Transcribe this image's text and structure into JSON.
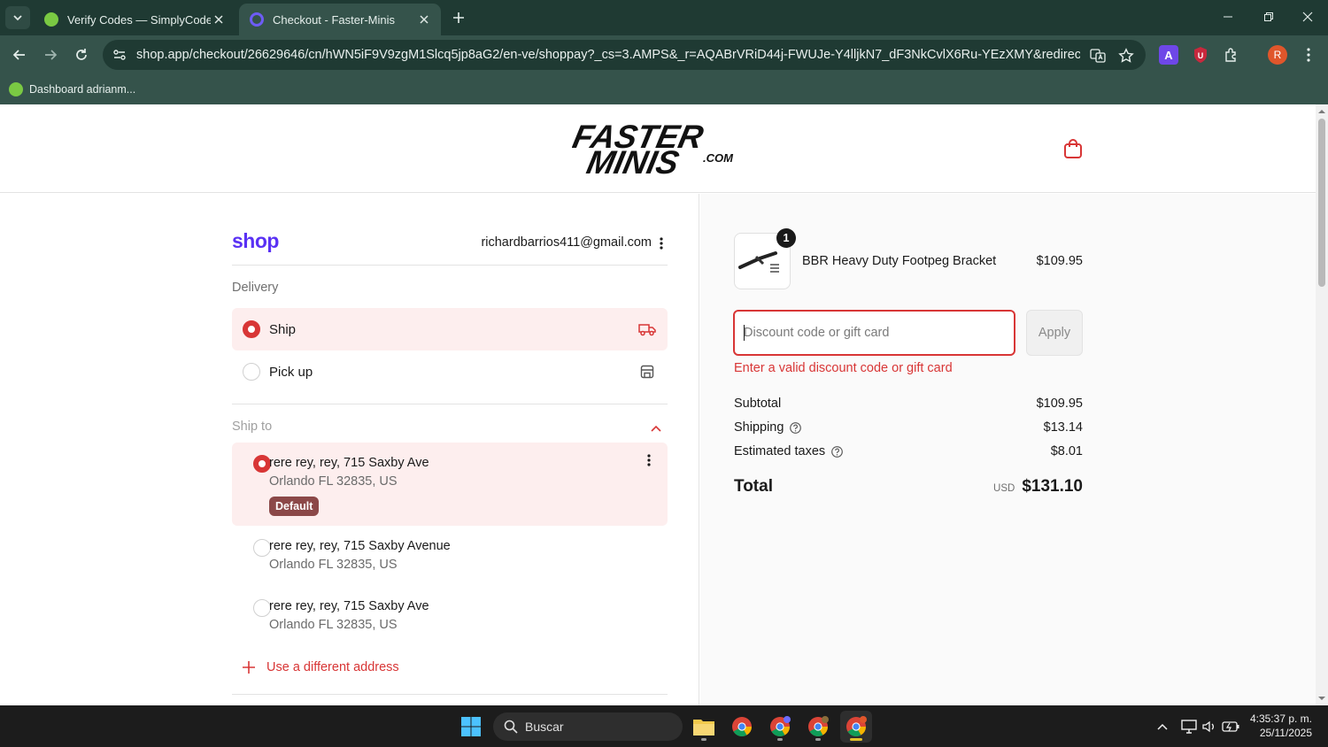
{
  "browser": {
    "tabs": [
      {
        "title": "Verify Codes — SimplyCodes",
        "favicon_color": "#7ac943"
      },
      {
        "title": "Checkout - Faster-Minis",
        "favicon_color": "#6d5cf5",
        "active": true
      }
    ],
    "url": "shop.app/checkout/26629646/cn/hWN5iF9V9zgM1Slcq5jp8aG2/en-ve/shoppay?_cs=3.AMPS&_r=AQABrVRiD44j-FWUJe-Y4lljkN7_dF3NkCvlX6Ru-YEzXMY&redirect_source=ch...",
    "bookmark": "Dashboard adrianm...",
    "profile_initial": "R"
  },
  "site": {
    "logo_text_1": "FASTER",
    "logo_text_2": "MINIS",
    "logo_suffix": ".COM"
  },
  "checkout": {
    "shop_brand": "shop",
    "email": "richardbarrios411@gmail.com",
    "delivery_label": "Delivery",
    "delivery_options": [
      {
        "label": "Ship",
        "selected": true,
        "icon": "truck-icon"
      },
      {
        "label": "Pick up",
        "selected": false,
        "icon": "store-icon"
      }
    ],
    "ship_to_label": "Ship to",
    "addresses": [
      {
        "line1": "rere rey, rey, 715 Saxby Ave",
        "line2": "Orlando FL 32835, US",
        "badge": "Default",
        "selected": true
      },
      {
        "line1": "rere rey, rey, 715 Saxby Avenue",
        "line2": "Orlando FL 32835, US",
        "selected": false
      },
      {
        "line1": "rere rey, rey, 715 Saxby Ave",
        "line2": "Orlando FL 32835, US",
        "selected": false
      }
    ],
    "add_address": "Use a different address"
  },
  "summary": {
    "item": {
      "name": "BBR Heavy Duty Footpeg Bracket",
      "price": "$109.95",
      "qty": "1"
    },
    "discount": {
      "placeholder": "Discount code or gift card",
      "value": "",
      "apply": "Apply",
      "error": "Enter a valid discount code or gift card"
    },
    "subtotal_label": "Subtotal",
    "subtotal": "$109.95",
    "shipping_label": "Shipping",
    "shipping": "$13.14",
    "taxes_label": "Estimated taxes",
    "taxes": "$8.01",
    "total_label": "Total",
    "currency": "USD",
    "total": "$131.10"
  },
  "taskbar": {
    "search": "Buscar",
    "time": "4:35:37 p. m.",
    "date": "25/11/2025"
  },
  "colors": {
    "accent": "#d83636",
    "shop_purple": "#5a31f4",
    "browser_frame": "#1f3a33"
  }
}
